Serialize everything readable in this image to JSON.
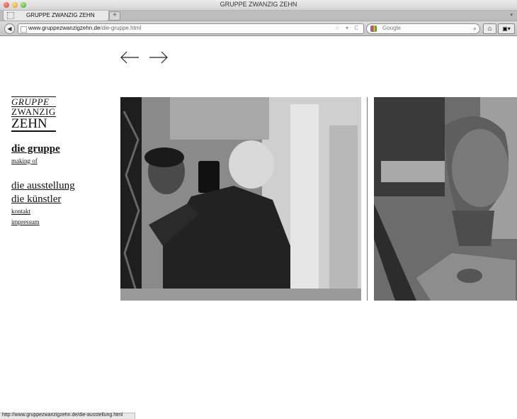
{
  "window": {
    "title": "GRUPPE ZWANZIG ZEHN"
  },
  "tab": {
    "label": "GRUPPE ZWANZIG ZEHN",
    "new_tab": "+",
    "menu": "▾"
  },
  "toolbar": {
    "back": "◀",
    "url_domain": "www.gruppezwanzigzehn.de",
    "url_path": "/die-gruppe.html",
    "url_icons": "☆ ▾ C",
    "search_placeholder": "Google",
    "search_icon": "⌕",
    "home": "⌂",
    "ext": "▣▾"
  },
  "page": {
    "nav_arrows": {
      "prev": "arrow-left-icon",
      "next": "arrow-right-icon"
    },
    "logo": {
      "line1": "GRUPPE",
      "line2": "ZWANZIG",
      "line3": "ZEHN"
    },
    "nav": {
      "die_gruppe": "die gruppe",
      "making_of": "making of",
      "die_ausstellung": "die ausstellung",
      "die_kuenstler": "die künstler",
      "kontakt": "kontakt",
      "impressum": "impressum"
    }
  },
  "status": {
    "text": "http://www.gruppezwanzigzehn.de/die-ausstellung.html"
  }
}
